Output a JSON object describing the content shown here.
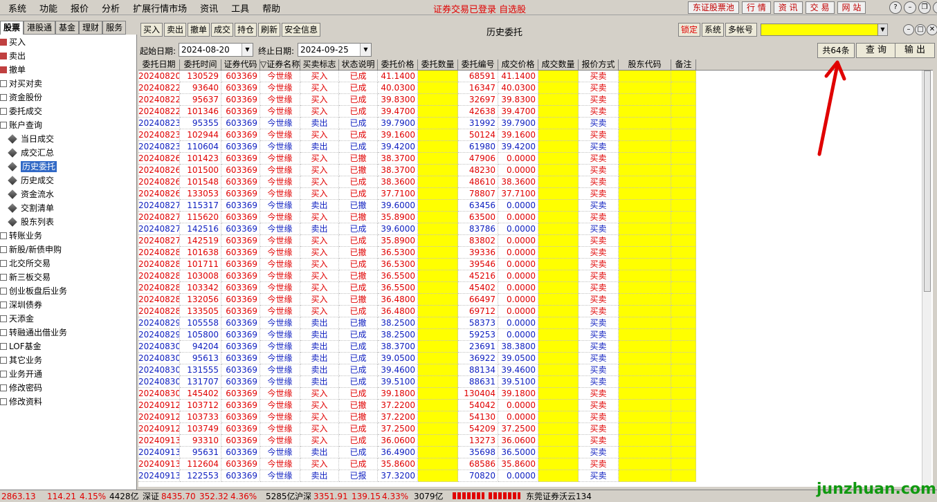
{
  "menu": [
    "系统",
    "功能",
    "报价",
    "分析",
    "扩展行情市场",
    "资讯",
    "工具",
    "帮助"
  ],
  "login_status": "证券交易已登录 自选股",
  "top_buttons": [
    "东证股票池",
    "行 情",
    "资 讯",
    "交 易",
    "网 站"
  ],
  "left_tabs": [
    "股票",
    "港股通",
    "基金",
    "理财",
    "服务"
  ],
  "tree": [
    {
      "label": "买入",
      "level": 0
    },
    {
      "label": "卖出",
      "level": 0
    },
    {
      "label": "撤单",
      "level": 0
    },
    {
      "label": "对买对卖",
      "level": 0
    },
    {
      "label": "资金股份",
      "level": 0
    },
    {
      "label": "委托成交",
      "level": 0
    },
    {
      "label": "账户查询",
      "level": 0
    },
    {
      "label": "当日成交",
      "level": 1
    },
    {
      "label": "成交汇总",
      "level": 1
    },
    {
      "label": "历史委托",
      "level": 1,
      "selected": true
    },
    {
      "label": "历史成交",
      "level": 1
    },
    {
      "label": "资金流水",
      "level": 1
    },
    {
      "label": "交割清单",
      "level": 1
    },
    {
      "label": "股东列表",
      "level": 1
    },
    {
      "label": "转账业务",
      "level": 0
    },
    {
      "label": "新股/新债申购",
      "level": 0
    },
    {
      "label": "北交所交易",
      "level": 0
    },
    {
      "label": "新三板交易",
      "level": 0
    },
    {
      "label": "创业板盘后业务",
      "level": 0
    },
    {
      "label": "深圳债券",
      "level": 0
    },
    {
      "label": "天添金",
      "level": 0
    },
    {
      "label": "转融通出借业务",
      "level": 0
    },
    {
      "label": "LOF基金",
      "level": 0
    },
    {
      "label": "其它业务",
      "level": 0
    },
    {
      "label": "业务开通",
      "level": 0
    },
    {
      "label": "修改密码",
      "level": 0
    },
    {
      "label": "修改资料",
      "level": 0
    }
  ],
  "toolbar": {
    "buttons": [
      "买入",
      "卖出",
      "撤单",
      "成交",
      "持仓",
      "刷新",
      "安全信息"
    ],
    "title": "历史委托",
    "right_buttons": [
      "锁定",
      "系统",
      "多帐号"
    ]
  },
  "query": {
    "start_label": "起始日期:",
    "start_date": "2024-08-20",
    "end_label": "终止日期:",
    "end_date": "2024-09-25",
    "count": "共64条",
    "query_button": "查 询",
    "export_button": "输 出"
  },
  "columns": [
    "委托日期",
    "委托时间",
    "证券代码",
    "▽证券名称",
    "买卖标志",
    "状态说明",
    "委托价格",
    "委托数量",
    "委托编号",
    "成交价格",
    "成交数量",
    "报价方式",
    "股东代码",
    "备注"
  ],
  "rows": [
    [
      "20240820",
      "130529",
      "603369",
      "今世缘",
      "买入",
      "已成",
      "41.1400",
      "68591",
      "41.1400",
      "买卖"
    ],
    [
      "20240822",
      "93640",
      "603369",
      "今世缘",
      "买入",
      "已成",
      "40.0300",
      "16347",
      "40.0300",
      "买卖"
    ],
    [
      "20240822",
      "95637",
      "603369",
      "今世缘",
      "买入",
      "已成",
      "39.8300",
      "32697",
      "39.8300",
      "买卖"
    ],
    [
      "20240822",
      "101346",
      "603369",
      "今世缘",
      "买入",
      "已成",
      "39.4700",
      "42638",
      "39.4700",
      "买卖"
    ],
    [
      "20240823",
      "95355",
      "603369",
      "今世缘",
      "卖出",
      "已成",
      "39.7900",
      "31992",
      "39.7900",
      "买卖"
    ],
    [
      "20240823",
      "102944",
      "603369",
      "今世缘",
      "买入",
      "已成",
      "39.1600",
      "50124",
      "39.1600",
      "买卖"
    ],
    [
      "20240823",
      "110604",
      "603369",
      "今世缘",
      "卖出",
      "已成",
      "39.4200",
      "61980",
      "39.4200",
      "买卖"
    ],
    [
      "20240826",
      "101423",
      "603369",
      "今世缘",
      "买入",
      "已撤",
      "38.3700",
      "47906",
      "0.0000",
      "买卖"
    ],
    [
      "20240826",
      "101500",
      "603369",
      "今世缘",
      "买入",
      "已撤",
      "38.3700",
      "48230",
      "0.0000",
      "买卖"
    ],
    [
      "20240826",
      "101548",
      "603369",
      "今世缘",
      "买入",
      "已成",
      "38.3600",
      "48610",
      "38.3600",
      "买卖"
    ],
    [
      "20240826",
      "133053",
      "603369",
      "今世缘",
      "买入",
      "已成",
      "37.7100",
      "78807",
      "37.7100",
      "买卖"
    ],
    [
      "20240827",
      "115317",
      "603369",
      "今世缘",
      "卖出",
      "已撤",
      "39.6000",
      "63456",
      "0.0000",
      "买卖"
    ],
    [
      "20240827",
      "115620",
      "603369",
      "今世缘",
      "买入",
      "已撤",
      "35.8900",
      "63500",
      "0.0000",
      "买卖"
    ],
    [
      "20240827",
      "142516",
      "603369",
      "今世缘",
      "卖出",
      "已成",
      "39.6000",
      "83786",
      "0.0000",
      "买卖"
    ],
    [
      "20240827",
      "142519",
      "603369",
      "今世缘",
      "买入",
      "已成",
      "35.8900",
      "83802",
      "0.0000",
      "买卖"
    ],
    [
      "20240828",
      "101638",
      "603369",
      "今世缘",
      "买入",
      "已撤",
      "36.5300",
      "39336",
      "0.0000",
      "买卖"
    ],
    [
      "20240828",
      "101711",
      "603369",
      "今世缘",
      "买入",
      "已成",
      "36.5300",
      "39546",
      "0.0000",
      "买卖"
    ],
    [
      "20240828",
      "103008",
      "603369",
      "今世缘",
      "买入",
      "已撤",
      "36.5500",
      "45216",
      "0.0000",
      "买卖"
    ],
    [
      "20240828",
      "103342",
      "603369",
      "今世缘",
      "买入",
      "已成",
      "36.5500",
      "45402",
      "0.0000",
      "买卖"
    ],
    [
      "20240828",
      "132056",
      "603369",
      "今世缘",
      "买入",
      "已撤",
      "36.4800",
      "66497",
      "0.0000",
      "买卖"
    ],
    [
      "20240828",
      "133505",
      "603369",
      "今世缘",
      "买入",
      "已成",
      "36.4800",
      "69712",
      "0.0000",
      "买卖"
    ],
    [
      "20240829",
      "105558",
      "603369",
      "今世缘",
      "卖出",
      "已撤",
      "38.2500",
      "58373",
      "0.0000",
      "买卖"
    ],
    [
      "20240829",
      "105800",
      "603369",
      "今世缘",
      "卖出",
      "已成",
      "38.2500",
      "59253",
      "0.0000",
      "买卖"
    ],
    [
      "20240830",
      "94204",
      "603369",
      "今世缘",
      "卖出",
      "已成",
      "38.3700",
      "23691",
      "38.3800",
      "买卖"
    ],
    [
      "20240830",
      "95613",
      "603369",
      "今世缘",
      "卖出",
      "已成",
      "39.0500",
      "36922",
      "39.0500",
      "买卖"
    ],
    [
      "20240830",
      "131555",
      "603369",
      "今世缘",
      "卖出",
      "已成",
      "39.4600",
      "88134",
      "39.4600",
      "买卖"
    ],
    [
      "20240830",
      "131707",
      "603369",
      "今世缘",
      "卖出",
      "已成",
      "39.5100",
      "88631",
      "39.5100",
      "买卖"
    ],
    [
      "20240830",
      "145402",
      "603369",
      "今世缘",
      "买入",
      "已成",
      "39.1800",
      "130404",
      "39.1800",
      "买卖"
    ],
    [
      "20240912",
      "103712",
      "603369",
      "今世缘",
      "买入",
      "已撤",
      "37.2200",
      "54042",
      "0.0000",
      "买卖"
    ],
    [
      "20240912",
      "103733",
      "603369",
      "今世缘",
      "买入",
      "已撤",
      "37.2200",
      "54130",
      "0.0000",
      "买卖"
    ],
    [
      "20240912",
      "103749",
      "603369",
      "今世缘",
      "买入",
      "已成",
      "37.2500",
      "54209",
      "37.2500",
      "买卖"
    ],
    [
      "20240913",
      "93310",
      "603369",
      "今世缘",
      "买入",
      "已成",
      "36.0600",
      "13273",
      "36.0600",
      "买卖"
    ],
    [
      "20240913",
      "95631",
      "603369",
      "今世缘",
      "卖出",
      "已成",
      "36.4900",
      "35698",
      "36.5000",
      "买卖"
    ],
    [
      "20240913",
      "112604",
      "603369",
      "今世缘",
      "买入",
      "已成",
      "35.8600",
      "68586",
      "35.8600",
      "买卖"
    ],
    [
      "20240913",
      "122553",
      "603369",
      "今世缘",
      "卖出",
      "已报",
      "37.3200",
      "70820",
      "0.0000",
      "买卖"
    ]
  ],
  "statusbar": {
    "sh_index": "2863.13",
    "sh_chg": "114.21",
    "sh_pct": "4.15%",
    "sh_vol": "4428亿",
    "sz_label": "深证",
    "sz_index": "8435.70",
    "sz_chg": "352.32",
    "sz_pct": "4.36%",
    "sz_vol": "5285亿",
    "hs_label": "沪深",
    "hs_index": "3351.91",
    "hs_chg": "139.15",
    "hs_pct": "4.33%",
    "hs_vol": "3079亿",
    "broker": "东莞证券沃云134"
  },
  "watermark": "junzhuan.com",
  "colors": {
    "buy": "#e00000",
    "sell": "#1020c0",
    "highlight": "#ffff00",
    "arrow": "#e00000"
  }
}
